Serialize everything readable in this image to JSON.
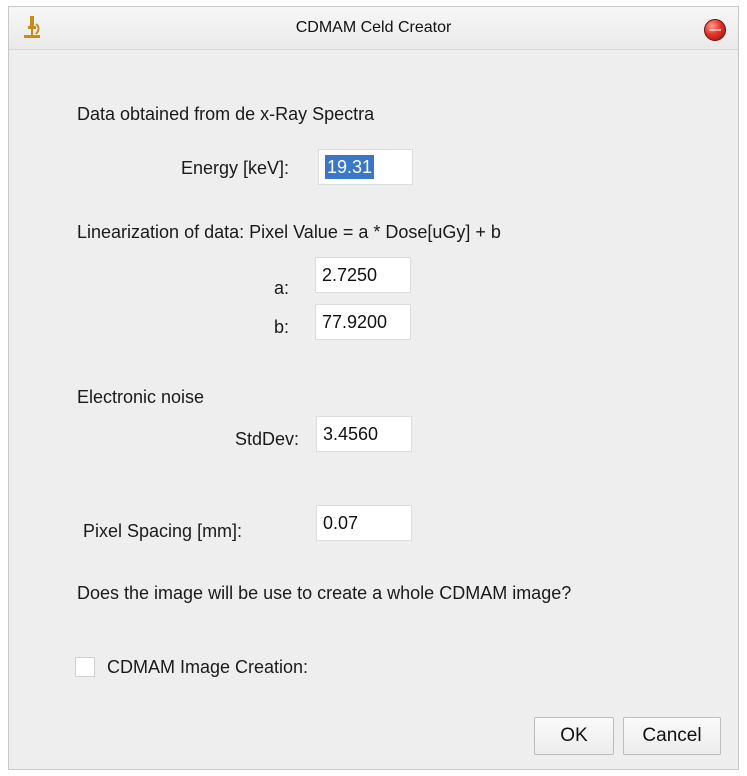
{
  "window": {
    "title": "CDMAM Celd Creator",
    "app_icon": "microscope-icon",
    "close_icon": "close-icon"
  },
  "spectra": {
    "heading": "Data obtained from de x-Ray Spectra",
    "energy_label": "Energy [keV]:",
    "energy_value": "19.31"
  },
  "linearization": {
    "heading": "Linearization of data: Pixel Value  = a * Dose[uGy] + b",
    "a_label": "a:",
    "a_value": "2.7250",
    "b_label": "b:",
    "b_value": "77.9200"
  },
  "noise": {
    "heading": "Electronic noise",
    "stddev_label": "StdDev:",
    "stddev_value": "3.4560"
  },
  "spacing": {
    "label": "Pixel Spacing [mm]:",
    "value": "0.07"
  },
  "question": "Does the image will be use to create a whole CDMAM image?",
  "creation": {
    "label": "CDMAM Image Creation:",
    "checked": false
  },
  "buttons": {
    "ok": "OK",
    "cancel": "Cancel"
  },
  "colors": {
    "selection": "#3a78c7",
    "close_button": "#e2362a",
    "icon": "#c98a1c"
  }
}
